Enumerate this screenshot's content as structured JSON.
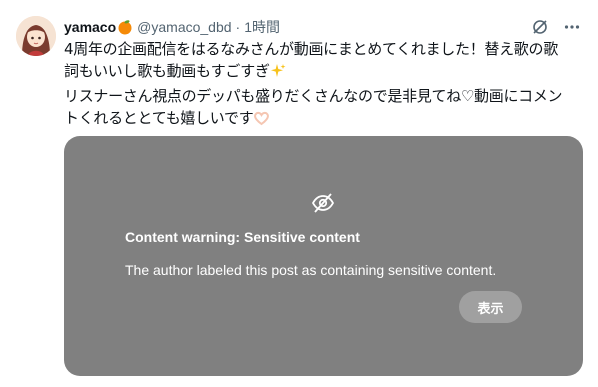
{
  "post": {
    "author": {
      "display_name": "yamaco",
      "name_emoji": "🍊",
      "handle": "@yamaco_dbd",
      "separator": "·",
      "timestamp": "1時間"
    },
    "text_lines": [
      "4周年の企画配信をはるなみさんが動画にまとめてくれました！替え歌の歌",
      "詞もいいし歌も動画もすごすぎ",
      "リスナーさん視点のデッパも盛りだくさんなので是非見てね♡動画にコメン",
      "トくれるととても嬉しいです"
    ],
    "line2_emoji": "✨",
    "line4_emoji": "🫶"
  },
  "content_warning": {
    "title": "Content warning: Sensitive content",
    "description": "The author labeled this post as containing sensitive content.",
    "show_button": "表示"
  },
  "icons": {
    "header": [
      "grok-icon",
      "more-icon"
    ],
    "warning": "eye-slash-icon"
  },
  "colors": {
    "media_background": "#808080",
    "secondary_text": "#536471",
    "primary_text": "#0f1419"
  }
}
